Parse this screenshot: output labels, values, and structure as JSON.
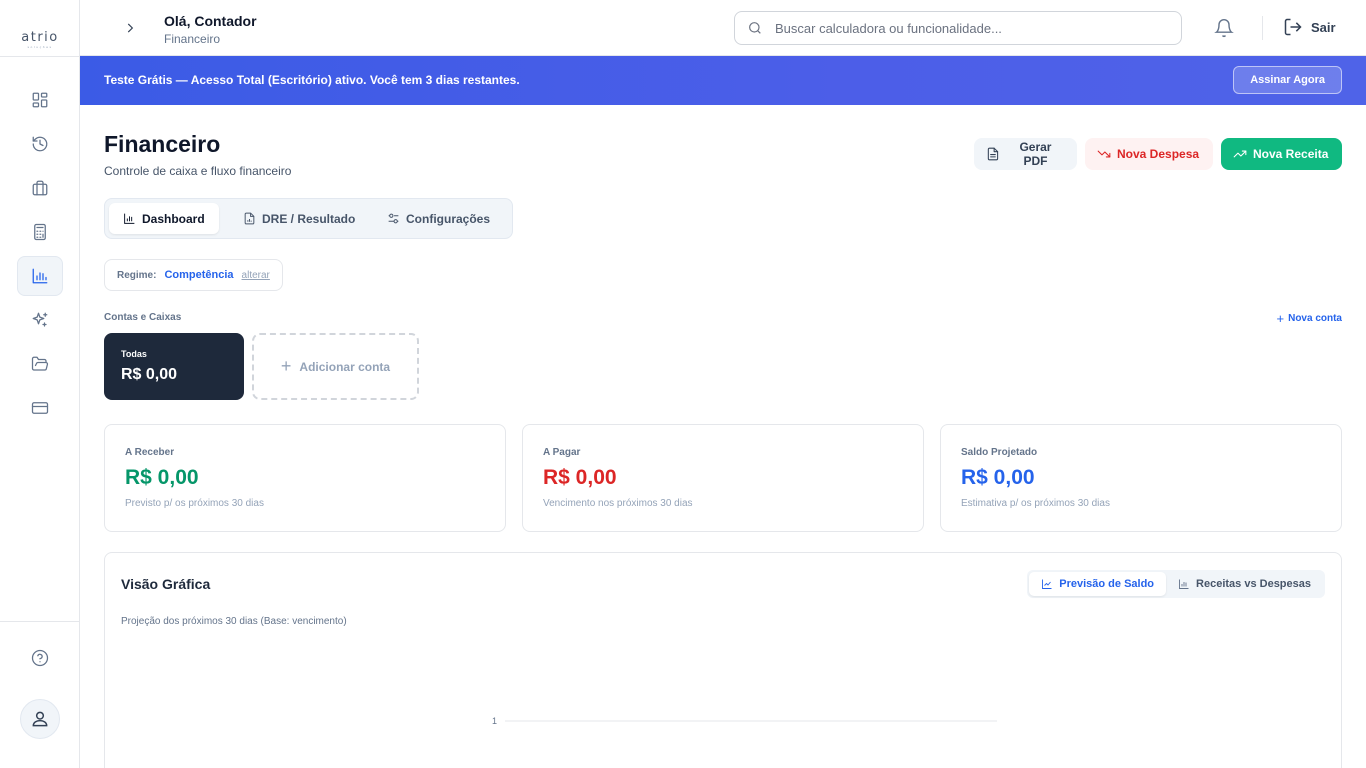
{
  "app": {
    "logo": "atrio",
    "logo_sub": "soluções"
  },
  "header": {
    "greeting": "Olá, Contador",
    "subtitle": "Financeiro",
    "search_placeholder": "Buscar calculadora ou funcionalidade...",
    "logout_label": "Sair"
  },
  "banner": {
    "text": "Teste Grátis — Acesso Total (Escritório) ativo. Você tem 3 dias restantes.",
    "button": "Assinar Agora"
  },
  "page": {
    "title": "Financeiro",
    "subtitle": "Controle de caixa e fluxo financeiro",
    "actions": {
      "pdf": "Gerar PDF",
      "expense": "Nova Despesa",
      "income": "Nova Receita"
    },
    "tabs": [
      {
        "label": "Dashboard",
        "active": true
      },
      {
        "label": "DRE / Resultado",
        "active": false
      },
      {
        "label": "Configurações",
        "active": false
      }
    ],
    "regime": {
      "label": "Regime:",
      "value": "Competência",
      "change": "alterar"
    }
  },
  "accounts": {
    "section_label": "Contas e Caixas",
    "new_account": "Nova conta",
    "items": [
      {
        "name": "Todas",
        "balance": "R$ 0,00"
      }
    ],
    "add_label": "Adicionar conta"
  },
  "kpis": [
    {
      "title": "A Receber",
      "value": "R$ 0,00",
      "sub": "Previsto p/ os próximos 30 dias",
      "color": "#059669"
    },
    {
      "title": "A Pagar",
      "value": "R$ 0,00",
      "sub": "Vencimento nos próximos 30 dias",
      "color": "#dc2626"
    },
    {
      "title": "Saldo Projetado",
      "value": "R$ 0,00",
      "sub": "Estimativa p/ os próximos 30 dias",
      "color": "#2563eb"
    }
  ],
  "chart_section": {
    "title": "Visão Gráfica",
    "subtitle": "Projeção dos próximos 30 dias (Base: vencimento)",
    "toggles": [
      {
        "label": "Previsão de Saldo",
        "active": true
      },
      {
        "label": "Receitas vs Despesas",
        "active": false
      }
    ]
  },
  "chart_data": {
    "type": "line",
    "y_ticks": [
      1
    ],
    "x": [],
    "series": []
  },
  "colors": {
    "accent": "#2563eb",
    "income": "#10b981",
    "expense": "#dc2626",
    "dark_card": "#1e293b"
  }
}
